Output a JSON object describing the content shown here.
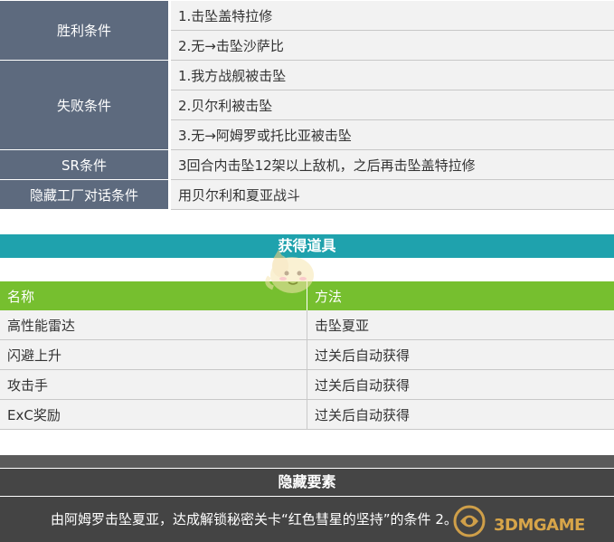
{
  "conditions": {
    "victory_label": "胜利条件",
    "victory": [
      "1.击坠盖特拉修",
      "2.无→击坠沙萨比"
    ],
    "defeat_label": "失败条件",
    "defeat": [
      "1.我方战舰被击坠",
      "2.贝尔利被击坠",
      "3.无→阿姆罗或托比亚被击坠"
    ],
    "sr_label": "SR条件",
    "sr": "3回合内击坠12架以上敌机，之后再击坠盖特拉修",
    "hidden_factory_label": "隐藏工厂对话条件",
    "hidden_factory": "用贝尔利和夏亚战斗"
  },
  "items_section": {
    "title": "获得道具",
    "header_name": "名称",
    "header_method": "方法",
    "rows": [
      {
        "name": "高性能雷达",
        "method": "击坠夏亚"
      },
      {
        "name": "闪避上升",
        "method": "过关后自动获得"
      },
      {
        "name": "攻击手",
        "method": "过关后自动获得"
      },
      {
        "name": "ExC奖励",
        "method": "过关后自动获得"
      }
    ]
  },
  "hidden_section": {
    "title": "隐藏要素",
    "text": "由阿姆罗击坠夏亚，达成解锁秘密关卡“红色彗星的坚持”的条件 2。"
  },
  "watermark": {
    "text": "3DMGAME"
  },
  "colors": {
    "label_bg": "#5d6a7e",
    "value_bg": "#f2f2f2",
    "teal": "#1fa2ad",
    "green": "#76bf2f",
    "dark": "#454545"
  }
}
